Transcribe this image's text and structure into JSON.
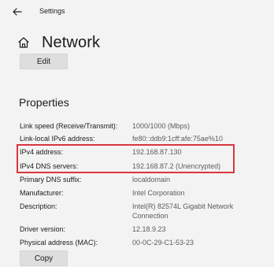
{
  "window": {
    "title": "Settings"
  },
  "header": {
    "title": "Network"
  },
  "actions": {
    "edit_label": "Edit",
    "copy_label": "Copy"
  },
  "properties": {
    "heading": "Properties",
    "items": [
      {
        "label": "Link speed (Receive/Transmit):",
        "value": "1000/1000 (Mbps)"
      },
      {
        "label": "Link-local IPv6 address:",
        "value": "fe80::ddb9:1cff:afe:75ae%10"
      },
      {
        "label": "IPv4 address:",
        "value": "192.168.87.130"
      },
      {
        "label": "IPv4 DNS servers:",
        "value": "192.168.87.2 (Unencrypted)"
      },
      {
        "label": "Primary DNS suffix:",
        "value": "localdomain"
      },
      {
        "label": "Manufacturer:",
        "value": "Intel Corporation"
      },
      {
        "label": "Description:",
        "value": "Intel(R) 82574L Gigabit Network",
        "value2": "Connection"
      },
      {
        "label": "Driver version:",
        "value": "12.18.9.23"
      },
      {
        "label": "Physical address (MAC):",
        "value": "00-0C-29-C1-53-23"
      }
    ]
  },
  "icons": {
    "back": "back-arrow-icon",
    "home": "home-icon"
  },
  "colors": {
    "background": "#f3f3f3",
    "button": "#dedede",
    "highlight": "#d9363e",
    "secondary_text": "#5c5c5c"
  }
}
